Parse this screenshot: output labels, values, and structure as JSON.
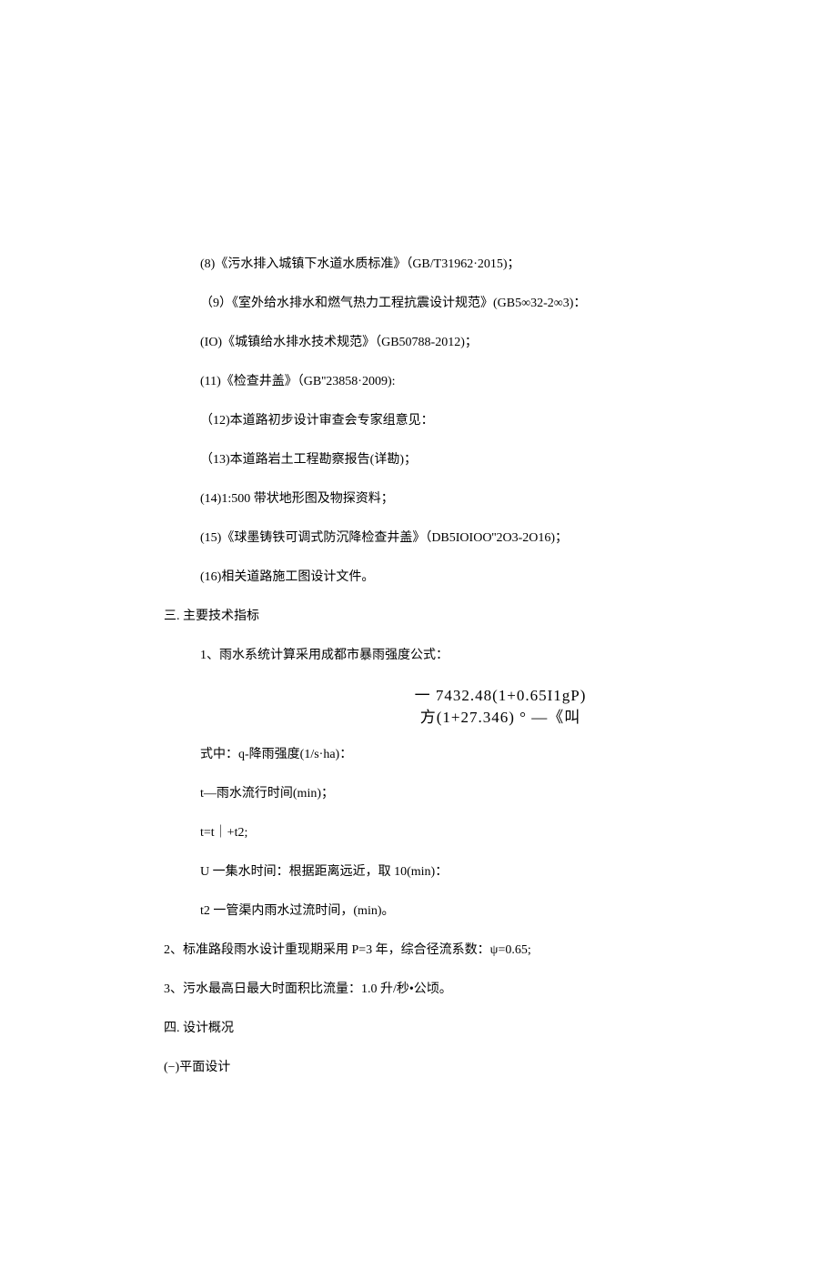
{
  "refs": {
    "r8": "(8)《污水排入城镇下水道水质标准》（GB/T31962·2015)；",
    "r9": "（9）《室外给水排水和燃气热力工程抗震设计规范》(GB5∞32-2∞3)：",
    "r10": "(IO)《城镇给水排水技术规范》（GB50788-2012)；",
    "r11": "(11)《检查井盖》（GB''23858·2009):",
    "r12": "（12)本道路初步设计审查会专家组意见：",
    "r13": "（13)本道路岩土工程勘察报告(详勘)；",
    "r14": "(14)1:500 带状地形图及物探资料；",
    "r15": "(15)《球墨铸铁可调式防沉降检查井盖》（DB5IOIOO''2O3-2O16)；",
    "r16": "(16)相关道路施工图设计文件。"
  },
  "sec3": {
    "heading": "三. 主要技术指标",
    "p1": "1、雨水系统计算采用成都市暴雨强度公式：",
    "formula_line1": "一 7432.48(1+0.65I1gP)",
    "formula_line2": "方(1+27.346) ° —《叫",
    "where_q": "式中：q-降雨强度(1/s·ha)：",
    "where_t": "t—雨水流行时间(min)；",
    "where_tt": "t=t｜+t2;",
    "where_u": "U 一集水时间：根据距离远近，取 10(min)：",
    "where_t2": "t2 一管渠内雨水过流时间，(min)。",
    "p2": "2、标准路段雨水设计重现期采用 P=3 年，综合径流系数：ψ=0.65;",
    "p3": "3、污水最高日最大时面积比流量：1.0 升/秒•公顷。"
  },
  "sec4": {
    "heading": "四. 设计概况",
    "sub1": "(−)平面设计"
  }
}
